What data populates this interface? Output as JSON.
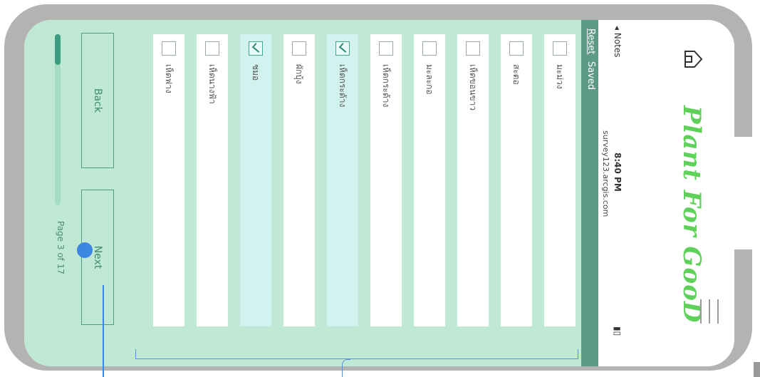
{
  "header": {
    "brand": "Plant For GooD",
    "menu_icon": "hamburger-icon",
    "home_icon": "home-icon"
  },
  "status_bar": {
    "back_app": "◂ Notes",
    "time": "8:40 PM",
    "url": "survey123.arcgis.com",
    "battery_icon": "battery-icon"
  },
  "toolbar": {
    "reset_label": "Reset",
    "saved_label": "Saved"
  },
  "choices": [
    {
      "label": "มะม่วง",
      "checked": false
    },
    {
      "label": "สะตอ",
      "checked": false
    },
    {
      "label": "เห็ดขอนขาว",
      "checked": false
    },
    {
      "label": "มะละกอ",
      "checked": false
    },
    {
      "label": "เห็ดกระด้าง",
      "checked": false
    },
    {
      "label": "เห็ดกระด้าง",
      "checked": true
    },
    {
      "label": "ผักบุ้ง",
      "checked": false
    },
    {
      "label": "ชมอ",
      "checked": true
    },
    {
      "label": "เห็ดนางฟ้า",
      "checked": false
    },
    {
      "label": "เห็ดฟาง",
      "checked": false
    }
  ],
  "nav": {
    "back_label": "Back",
    "next_label": "Next",
    "page_text": "Page 3 of 17",
    "progress": 0.18
  },
  "colors": {
    "accent": "#3a9d7f",
    "form_bg": "#bfe9d4",
    "checked_bg": "#d2f2ef",
    "brand_green": "#5fd15a",
    "annotation_blue": "#3b86de"
  }
}
